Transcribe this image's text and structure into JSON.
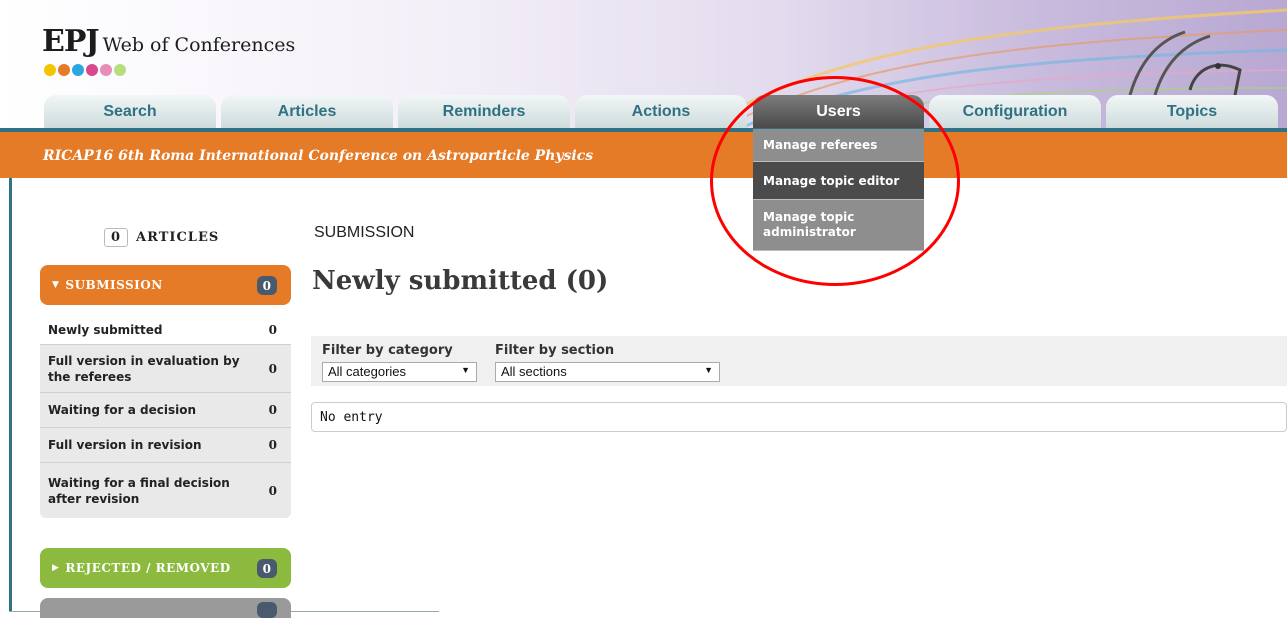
{
  "logo": {
    "epj": "EPJ",
    "rest": "Web of Conferences",
    "dot_colors": [
      "#f5c400",
      "#e57a27",
      "#2aa7df",
      "#d8488e",
      "#e58fb6",
      "#b7dd7d"
    ]
  },
  "nav": {
    "tabs": [
      {
        "label": "Search"
      },
      {
        "label": "Articles"
      },
      {
        "label": "Reminders"
      },
      {
        "label": "Actions"
      },
      {
        "label": "Users"
      },
      {
        "label": "Configuration"
      },
      {
        "label": "Topics"
      }
    ],
    "active": "Users"
  },
  "users_menu": {
    "items": [
      {
        "label": "Manage referees"
      },
      {
        "label": "Manage topic editor"
      },
      {
        "label": "Manage topic administrator"
      }
    ],
    "highlighted": "Manage topic editor"
  },
  "conference_title": "RICAP16 6th Roma International Conference on Astroparticle Physics",
  "sidebar": {
    "articles_count": "0",
    "articles_label": "ARTICLES",
    "submission": {
      "label": "SUBMISSION",
      "icon": "caret-down-icon",
      "count": "0",
      "color": "#e57a27",
      "items": [
        {
          "label": "Newly submitted",
          "count": "0"
        },
        {
          "label": "Full version in evaluation by the referees",
          "count": "0"
        },
        {
          "label": "Waiting for a decision",
          "count": "0"
        },
        {
          "label": "Full version in revision",
          "count": "0"
        },
        {
          "label": "Waiting for a final decision after revision",
          "count": "0"
        }
      ]
    },
    "rejected": {
      "label": "REJECTED / REMOVED",
      "icon": "caret-right-icon",
      "count": "0",
      "color": "#8cba3f"
    },
    "third_section": {
      "color": "#9a9a9a"
    }
  },
  "main": {
    "breadcrumb": "SUBMISSION",
    "title": "Newly submitted (0)",
    "filters": {
      "category_label": "Filter by category",
      "category_value": "All categories",
      "section_label": "Filter by section",
      "section_value": "All sections"
    },
    "empty_text": "No entry"
  },
  "annotation": {
    "circle_color": "#ff0000"
  }
}
